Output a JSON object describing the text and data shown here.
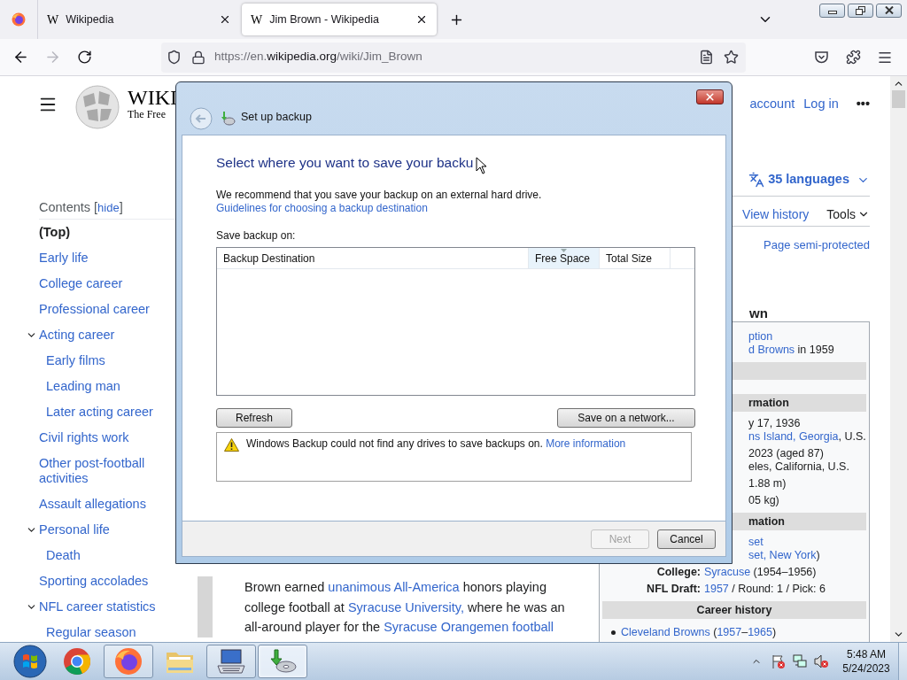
{
  "browser": {
    "tabs": [
      {
        "icon_glyph": "W",
        "label": "Wikipedia",
        "selected": false
      },
      {
        "icon_glyph": "W",
        "label": "Jim Brown - Wikipedia",
        "selected": true
      }
    ],
    "navigation": {
      "back_disabled": false,
      "forward_disabled": true
    },
    "url": {
      "prefix": "https://en.",
      "host": "wikipedia.org",
      "path": "/wiki/Jim_Brown"
    }
  },
  "page": {
    "wordmark": "WIKI",
    "tagline": "The Free",
    "user_links": [
      "account",
      "Log in"
    ],
    "more": "•••",
    "languages": "35 languages",
    "actions": [
      "View history",
      "Tools"
    ],
    "protection": "Page semi-protected",
    "contents_title": "Contents",
    "hide_open": "[",
    "hide_label": "hide",
    "hide_close": "]",
    "toc": [
      {
        "label": "(Top)",
        "selected": true
      },
      {
        "label": "Early life",
        "selected": false
      },
      {
        "label": "College career",
        "selected": false
      },
      {
        "label": "Professional career",
        "selected": false
      },
      {
        "label": "Acting career",
        "selected": false,
        "expanded": true,
        "children": [
          {
            "label": "Early films",
            "selected": false
          },
          {
            "label": "Leading man",
            "selected": false
          },
          {
            "label": "Later acting career",
            "selected": false
          }
        ]
      },
      {
        "label": "Civil rights work",
        "selected": false
      },
      {
        "label": "Other post-football activities",
        "selected": false
      },
      {
        "label": "Assault allegations",
        "selected": false
      },
      {
        "label": "Personal life",
        "selected": false,
        "expanded": true,
        "children": [
          {
            "label": "Death",
            "selected": false
          }
        ]
      },
      {
        "label": "Sporting accolades",
        "selected": false
      },
      {
        "label": "NFL career statistics",
        "selected": false,
        "expanded": true,
        "children": [
          {
            "label": "Regular season",
            "selected": false
          }
        ]
      }
    ],
    "heading_fragment": "wn",
    "infobox": [
      {
        "kind": "value",
        "lines": [
          [
            {
              "t": "ption",
              "link": true
            }
          ],
          [
            {
              "t": "d Browns",
              "link": true
            },
            {
              "t": " in 1959",
              "link": false
            }
          ]
        ]
      },
      {
        "kind": "header_fragment"
      },
      {
        "kind": "spacer"
      },
      {
        "kind": "header_fragment",
        "label": "rmation"
      },
      {
        "kind": "value",
        "lines": [
          [
            {
              "t": "y 17, 1936",
              "link": false
            }
          ],
          [
            {
              "t": "ns Island, Georgia",
              "link": true
            },
            {
              "t": ", U.S.",
              "link": false
            }
          ]
        ]
      },
      {
        "kind": "value",
        "lines": [
          [
            {
              "t": "2023 (aged 87)",
              "link": false
            }
          ],
          [
            {
              "t": "eles, California, U.S.",
              "link": false
            }
          ]
        ]
      },
      {
        "kind": "value",
        "lines": [
          [
            {
              "t": "1.88 m)",
              "link": false
            }
          ]
        ]
      },
      {
        "kind": "value",
        "lines": [
          [
            {
              "t": "05 kg)",
              "link": false
            }
          ]
        ]
      },
      {
        "kind": "header_fragment",
        "label": "mation"
      },
      {
        "kind": "value",
        "lines": [
          [
            {
              "t": "set",
              "link": true
            }
          ],
          [
            {
              "t": "set, New York",
              "link": true
            },
            {
              "t": ")",
              "link": false
            }
          ]
        ]
      },
      {
        "kind": "field",
        "label": "College:",
        "value": [
          {
            "t": "Syracuse",
            "link": true
          },
          {
            "t": " (1954–1956)",
            "link": false
          }
        ]
      },
      {
        "kind": "field",
        "label": "NFL Draft:",
        "value": [
          {
            "t": "1957",
            "link": true
          },
          {
            "t": " / Round: 1 / Pick: 6",
            "link": false
          }
        ]
      },
      {
        "kind": "header",
        "label": "Career history"
      },
      {
        "kind": "list_item",
        "value": [
          {
            "t": "Cleveland Browns",
            "link": true
          },
          {
            "t": " (",
            "link": false
          },
          {
            "t": "1957",
            "link": true
          },
          {
            "t": "–",
            "link": false
          },
          {
            "t": "1965",
            "link": true
          },
          {
            "t": ")",
            "link": false
          }
        ]
      }
    ],
    "body_paragraph": [
      {
        "t": "Brown earned ",
        "link": false
      },
      {
        "t": "unanimous All-America",
        "link": true
      },
      {
        "t": " honors playing college football at ",
        "link": false
      },
      {
        "t": "Syracuse University,",
        "link": true
      },
      {
        "t": " where he was an all-around player for the ",
        "link": false
      },
      {
        "t": "Syracuse Orangemen football",
        "link": true
      }
    ]
  },
  "dialog": {
    "title": "Set up backup",
    "heading": "Select where you want to save your backu",
    "intro": [
      {
        "t": "We recommend that you save your backup on an external hard drive. ",
        "link": false
      },
      {
        "t": "Guidelines for choosing a backup destination",
        "link": true
      }
    ],
    "list_label": "Save backup on:",
    "columns": [
      {
        "label": "Backup Destination",
        "sorted": false
      },
      {
        "label": "Free Space",
        "sorted": true
      },
      {
        "label": "Total Size",
        "sorted": false
      }
    ],
    "refresh": {
      "label": "Refresh",
      "disabled": false
    },
    "network": {
      "label": "Save on a network...",
      "disabled": false
    },
    "warning": [
      {
        "t": "Windows Backup could not find any drives to save backups on. ",
        "link": false
      },
      {
        "t": "More information",
        "link": true
      }
    ],
    "footer_buttons": [
      {
        "label": "Next",
        "disabled": true
      },
      {
        "label": "Cancel",
        "disabled": false
      }
    ]
  },
  "taskbar": {
    "apps": [
      {
        "kind": "chrome",
        "running": false,
        "selected": false
      },
      {
        "kind": "firefox",
        "running": true,
        "selected": false
      },
      {
        "kind": "explorer",
        "running": false,
        "selected": false
      },
      {
        "kind": "keyboard",
        "running": true,
        "selected": false
      },
      {
        "kind": "backup",
        "running": true,
        "selected": true
      }
    ],
    "time": "5:48 AM",
    "date": "5/24/2023"
  }
}
